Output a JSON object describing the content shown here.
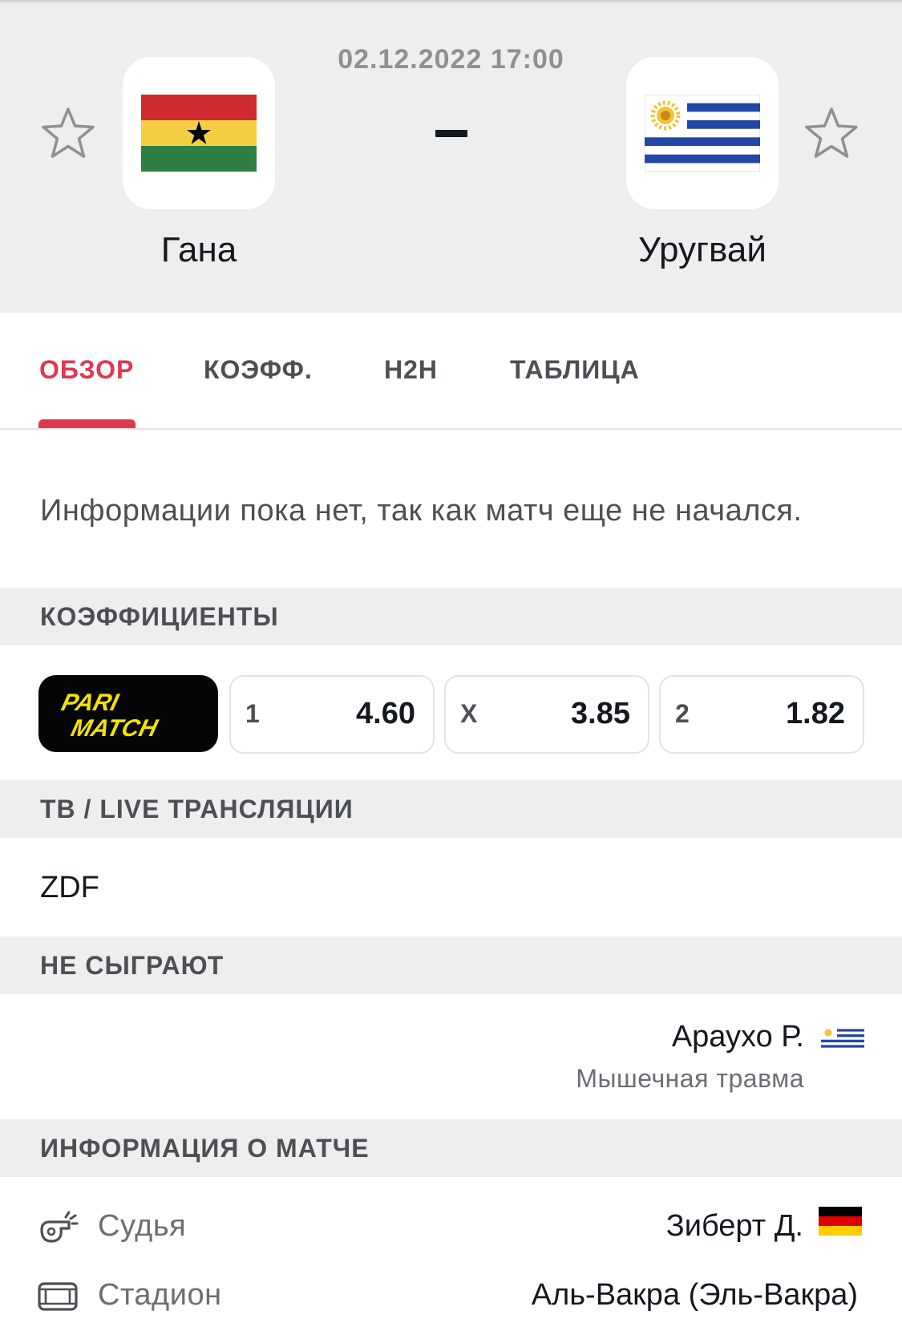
{
  "match": {
    "datetime": "02.12.2022 17:00",
    "home_team": "Гана",
    "away_team": "Уругвай",
    "home_flag_icon": "ghana-flag-icon",
    "away_flag_icon": "uruguay-flag-icon"
  },
  "tabs": [
    {
      "label": "ОБЗОР",
      "active": true
    },
    {
      "label": "КОЭФФ.",
      "active": false
    },
    {
      "label": "H2H",
      "active": false
    },
    {
      "label": "ТАБЛИЦА",
      "active": false
    }
  ],
  "overview": {
    "no_info_text": "Информации пока нет, так как матч еще не начался."
  },
  "odds": {
    "section_title": "КОЭФФИЦИЕНТЫ",
    "bookmaker_logo_text": [
      "PARI",
      "MATCH"
    ],
    "items": [
      {
        "label": "1",
        "value": "4.60"
      },
      {
        "label": "X",
        "value": "3.85"
      },
      {
        "label": "2",
        "value": "1.82"
      }
    ]
  },
  "tv": {
    "section_title": "ТВ / LIVE ТРАНСЛЯЦИИ",
    "channel": "ZDF"
  },
  "missing": {
    "section_title": "НЕ СЫГРАЮТ",
    "player_name": "Араухо Р.",
    "reason": "Мышечная травма",
    "flag_icon": "uruguay-flag-icon"
  },
  "match_info": {
    "section_title": "ИНФОРМАЦИЯ О МАТЧЕ",
    "referee_label": "Судья",
    "referee_value": "Зиберт Д.",
    "referee_flag_icon": "germany-flag-icon",
    "stadium_label": "Стадион",
    "stadium_value": "Аль-Вакра (Эль-Вакра)"
  },
  "colors": {
    "accent": "#e0384e",
    "header_bg": "#eeeeef",
    "bookmaker_yellow": "#f3e300"
  }
}
